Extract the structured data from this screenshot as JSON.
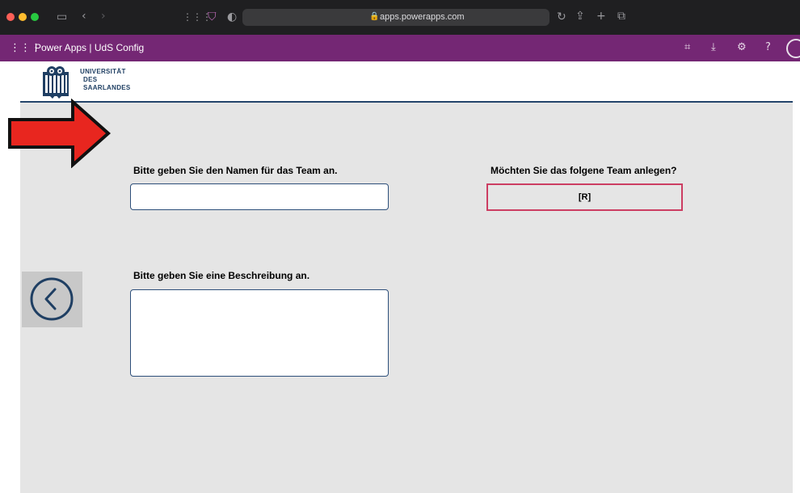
{
  "browser": {
    "url": "apps.powerapps.com",
    "icons": [
      "sidebar-icon",
      "back-icon",
      "forward-icon",
      "extensions-icon",
      "shield-icon",
      "privacy-icon",
      "reload-icon",
      "share-icon",
      "new-tab-icon",
      "tabs-icon"
    ]
  },
  "header": {
    "app_title": "Power Apps  |  UdS Config",
    "brand_color": "#742774",
    "icons": [
      "waffle-icon",
      "fit-icon",
      "download-icon",
      "settings-icon",
      "help-icon",
      "avatar"
    ]
  },
  "logo": {
    "line1": "UNIVERSITÄT",
    "line2": "DES",
    "line3": "SAARLANDES"
  },
  "form": {
    "name_label": "Bitte geben Sie den Namen für das Team an.",
    "name_value": "",
    "desc_label": "Bitte geben Sie eine Beschreibung an.",
    "desc_value": "",
    "confirm_label": "Möchten Sie das folgene Team anlegen?",
    "preview_value": "[R]"
  },
  "colors": {
    "accent_border": "#cc3d62",
    "input_border": "#2d4f7a",
    "arrow": "#e8261f"
  }
}
